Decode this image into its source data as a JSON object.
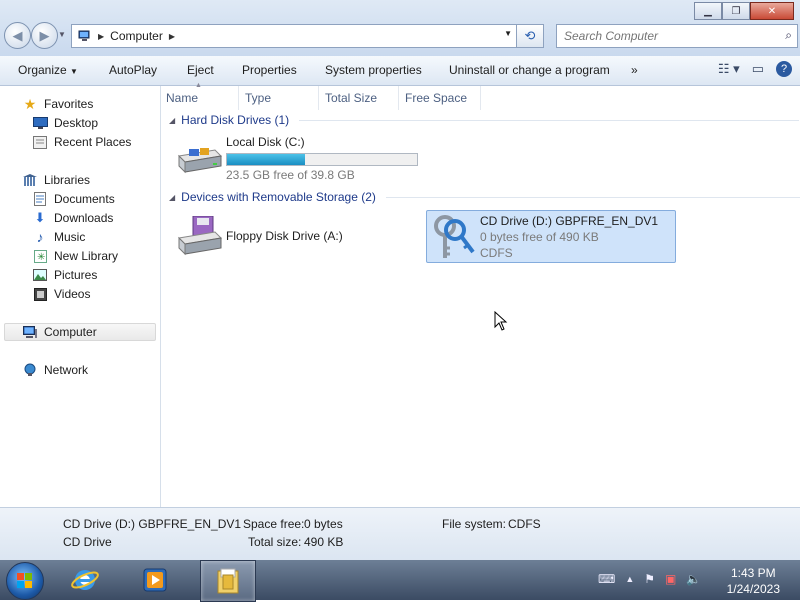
{
  "window": {
    "minimize_icon": "minimize-icon",
    "maximize_icon": "maximize-icon",
    "close_icon": "close-icon"
  },
  "address": {
    "crumb": "Computer",
    "search_placeholder": "Search Computer"
  },
  "toolbar": {
    "organize": "Organize",
    "autoplay": "AutoPlay",
    "eject": "Eject",
    "properties": "Properties",
    "system_properties": "System properties",
    "uninstall": "Uninstall or change a program",
    "more": "»"
  },
  "nav": {
    "favorites": "Favorites",
    "desktop": "Desktop",
    "recent": "Recent Places",
    "libraries": "Libraries",
    "documents": "Documents",
    "downloads": "Downloads",
    "music": "Music",
    "new_library": "New Library",
    "pictures": "Pictures",
    "videos": "Videos",
    "computer": "Computer",
    "network": "Network"
  },
  "columns": [
    "Name",
    "Type",
    "Total Size",
    "Free Space"
  ],
  "groups": {
    "hdd": "Hard Disk Drives (1)",
    "removable": "Devices with Removable Storage (2)"
  },
  "drives": {
    "c": {
      "name": "Local Disk (C:)",
      "free": "23.5 GB free of 39.8 GB",
      "used_fraction": 0.41
    },
    "a": {
      "name": "Floppy Disk Drive (A:)"
    },
    "d": {
      "name": "CD Drive (D:) GBPFRE_EN_DV1",
      "free": "0 bytes free of 490 KB",
      "fs": "CDFS"
    }
  },
  "details": {
    "title": "CD Drive (D:) GBPFRE_EN_DV1",
    "type": "CD Drive",
    "space_free_label": "Space free:",
    "space_free": "0 bytes",
    "total_size_label": "Total size:",
    "total_size": "490 KB",
    "fs_label": "File system:",
    "fs": "CDFS"
  },
  "taskbar": {
    "time": "1:43 PM",
    "date": "1/24/2023"
  },
  "colors": {
    "selection": "#cfe3fa",
    "group_text": "#1e3a8a",
    "bar_fill": "#1a8ec2"
  }
}
